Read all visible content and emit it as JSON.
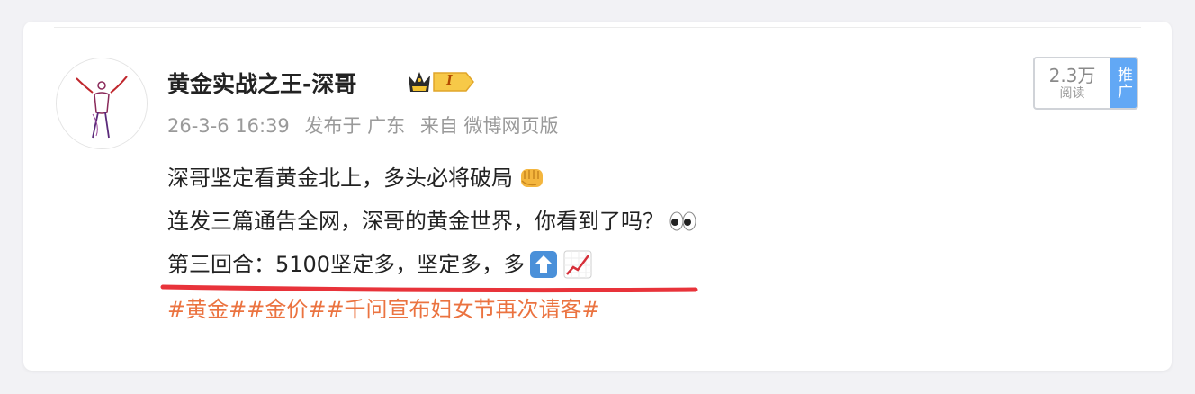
{
  "post": {
    "author": {
      "name": "黄金实战之王-深哥",
      "badge_level": "I"
    },
    "meta": {
      "time": "26-3-6 16:39",
      "location": "发布于 广东",
      "source": "来自 微博网页版"
    },
    "content": {
      "line1": "深哥坚定看黄金北上，多头必将破局",
      "line2": "连发三篇通告全网，深哥的黄金世界，你看到了吗？",
      "line3": "第三回合：5100坚定多，坚定多，多",
      "topics": [
        "#黄金#",
        "#金价#",
        "#千问宣布妇女节再次请客#"
      ],
      "emoji": [
        "fist-emoji",
        "eyes-emoji",
        "up-arrow-emoji",
        "chart-increasing-emoji"
      ]
    },
    "promotion": {
      "views": "2.3万",
      "views_label": "阅读",
      "button_label": "推广"
    }
  },
  "colors": {
    "topic": "#eb7340",
    "underline": "#e8333a",
    "promo_button": "#62a8f5",
    "text": "#222222",
    "meta": "#9a9a9a"
  }
}
